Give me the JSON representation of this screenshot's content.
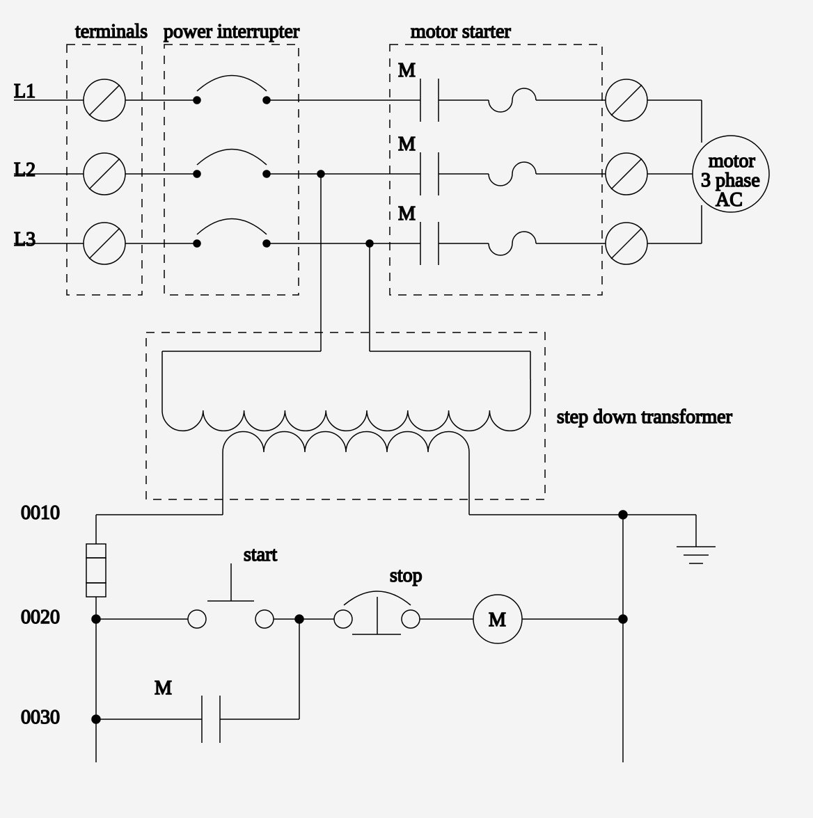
{
  "labels": {
    "terminals": "terminals",
    "power_interrupter": "power interrupter",
    "motor_starter": "motor starter",
    "step_down_transformer": "step down transformer",
    "m_label": "M",
    "motor_1": "motor",
    "motor_2": "3 phase",
    "motor_3": "AC",
    "start": "start",
    "stop": "stop",
    "rung_0010": "0010",
    "rung_0020": "0020",
    "rung_0030": "0030"
  },
  "lines": {
    "L1": "L1",
    "L2": "L2",
    "L3": "L3"
  }
}
